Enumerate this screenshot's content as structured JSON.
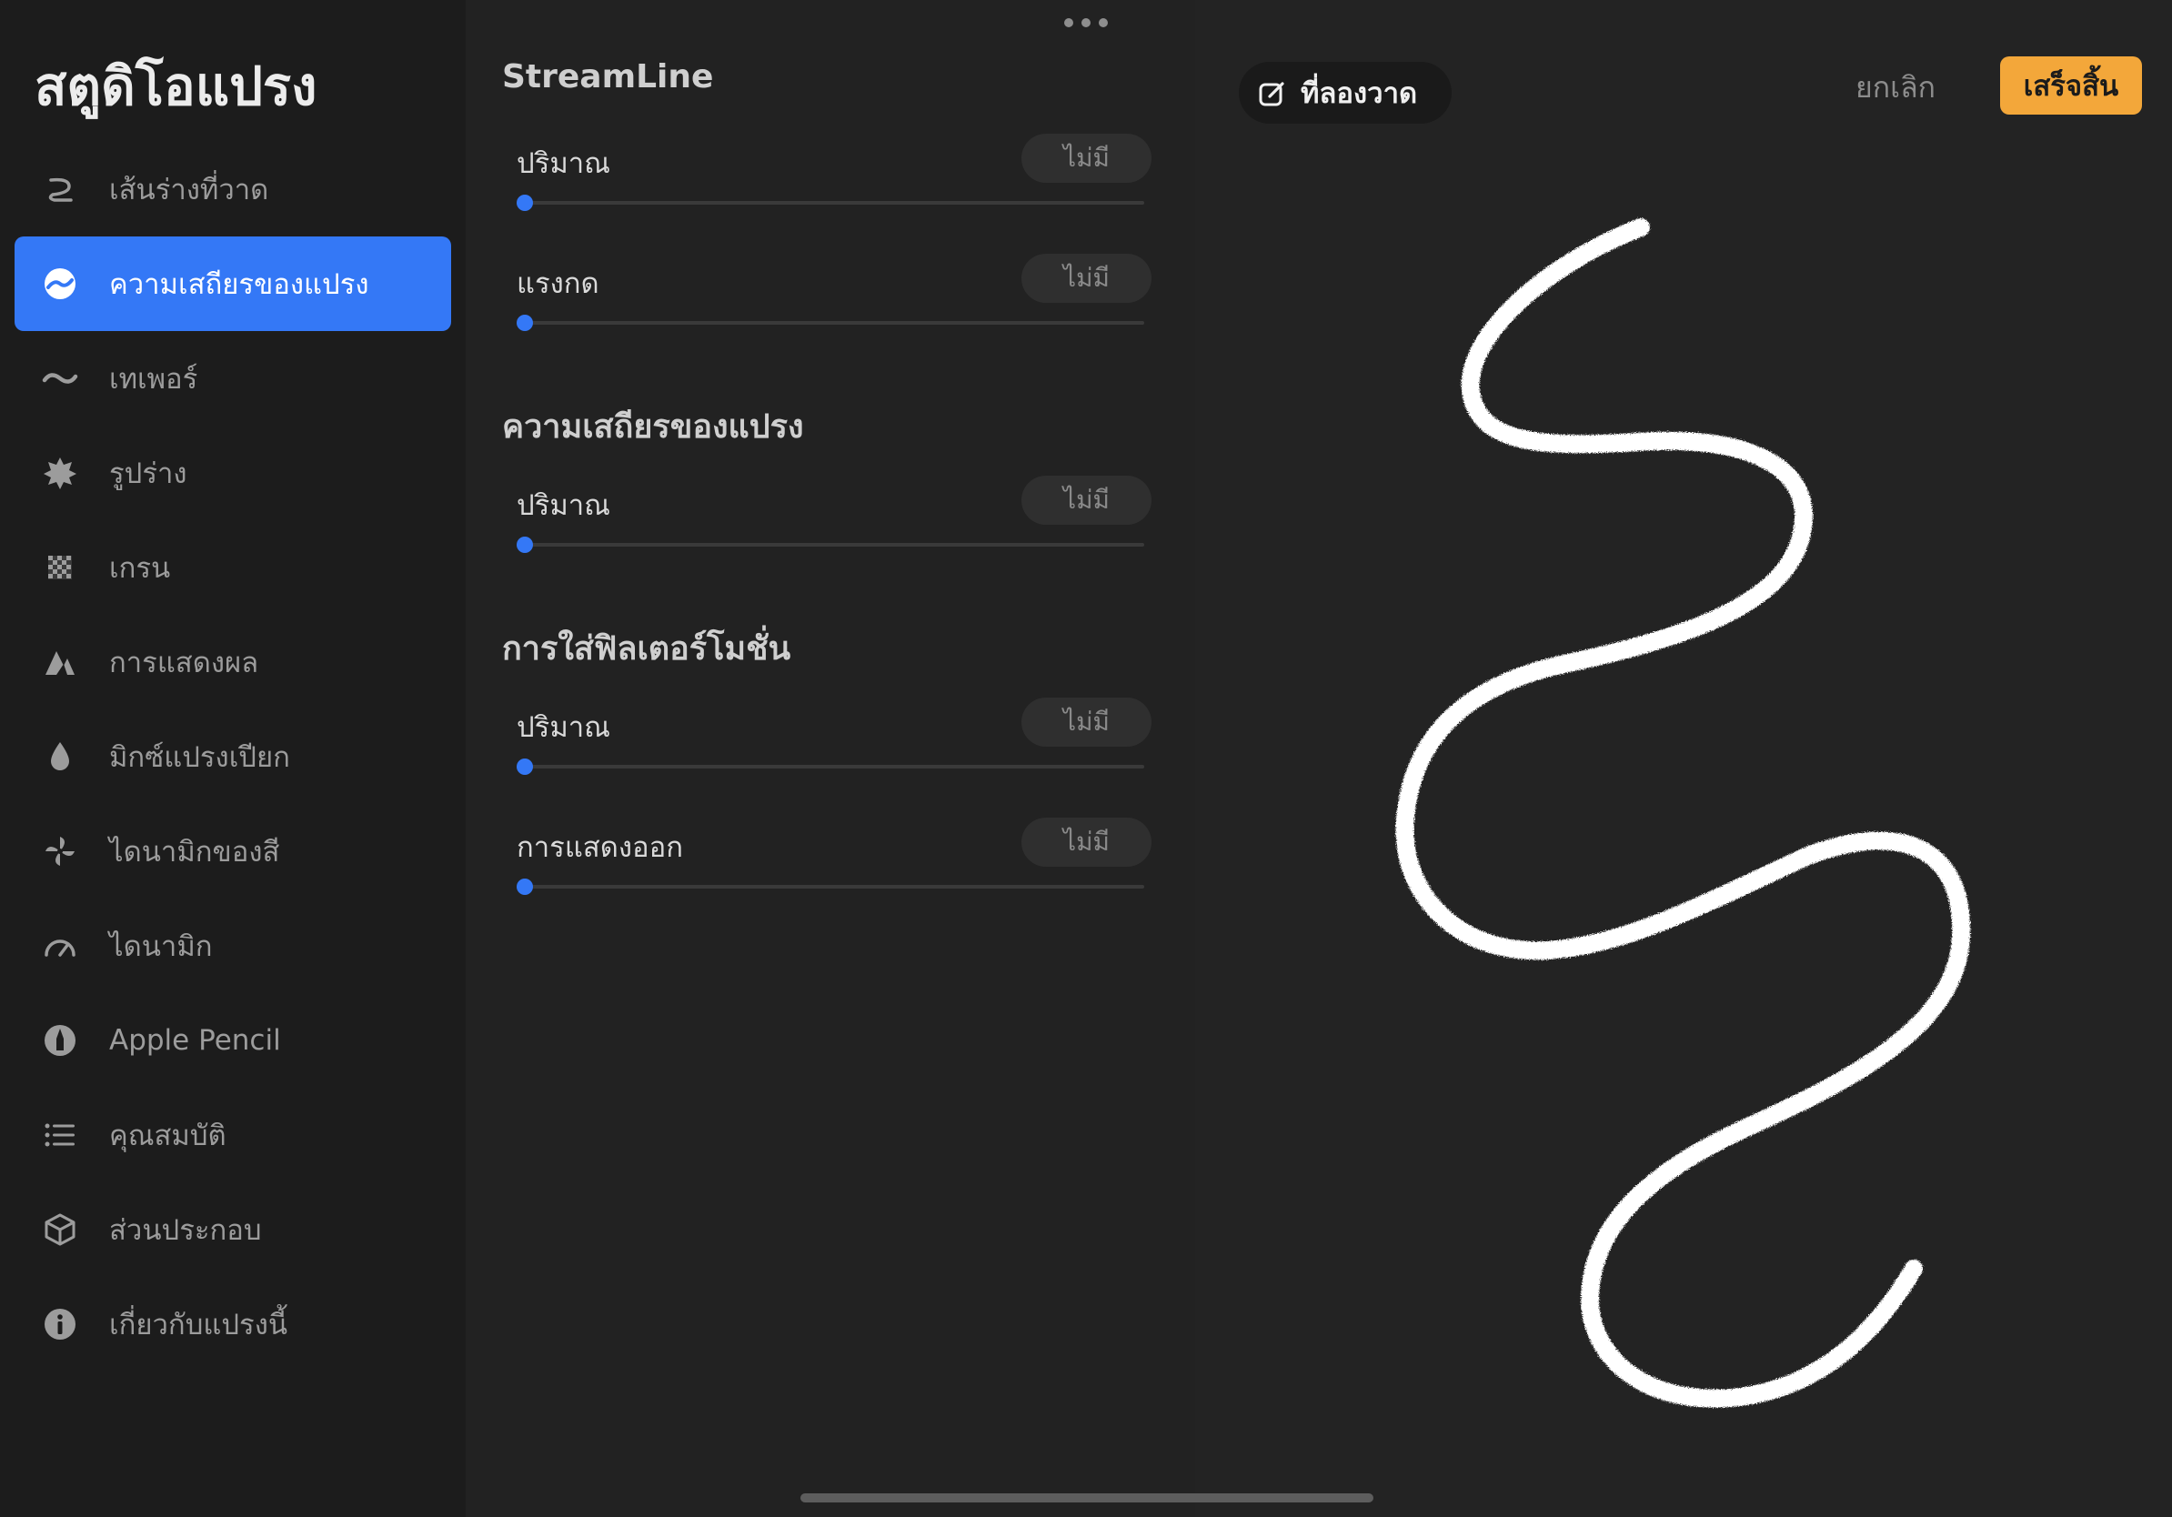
{
  "app": {
    "title": "สตูดิโอแปรง"
  },
  "sidebar": {
    "items": [
      {
        "label": "เส้นร่างที่วาด",
        "icon": "stroke-path-icon",
        "active": false
      },
      {
        "label": "ความเสถียรของแปรง",
        "icon": "stabilization-icon",
        "active": true
      },
      {
        "label": "เทเพอร์",
        "icon": "taper-icon",
        "active": false
      },
      {
        "label": "รูปร่าง",
        "icon": "shape-icon",
        "active": false
      },
      {
        "label": "เกรน",
        "icon": "grain-icon",
        "active": false
      },
      {
        "label": "การแสดงผล",
        "icon": "rendering-icon",
        "active": false
      },
      {
        "label": "มิกซ์แปรงเปียก",
        "icon": "wet-mix-icon",
        "active": false
      },
      {
        "label": "ไดนามิกของสี",
        "icon": "color-dynamics-icon",
        "active": false
      },
      {
        "label": "ไดนามิก",
        "icon": "dynamics-icon",
        "active": false
      },
      {
        "label": "Apple Pencil",
        "icon": "apple-pencil-icon",
        "active": false
      },
      {
        "label": "คุณสมบัติ",
        "icon": "properties-icon",
        "active": false
      },
      {
        "label": "ส่วนประกอบ",
        "icon": "materials-icon",
        "active": false
      },
      {
        "label": "เกี่ยวกับแปรงนี้",
        "icon": "info-icon",
        "active": false
      }
    ]
  },
  "settings": {
    "sections": [
      {
        "title": "StreamLine",
        "params": [
          {
            "label": "ปริมาณ",
            "value": "ไม่มี",
            "level": 0
          },
          {
            "label": "แรงกด",
            "value": "ไม่มี",
            "level": 0
          }
        ]
      },
      {
        "title": "ความเสถียรของแปรง",
        "params": [
          {
            "label": "ปริมาณ",
            "value": "ไม่มี",
            "level": 0
          }
        ]
      },
      {
        "title": "การใส่ฟิลเตอร์โมชั่น",
        "params": [
          {
            "label": "ปริมาณ",
            "value": "ไม่มี",
            "level": 0
          },
          {
            "label": "การแสดงออก",
            "value": "ไม่มี",
            "level": 0
          }
        ]
      }
    ]
  },
  "pad": {
    "chip_label": "ที่ลองวาด",
    "chip_icon": "edit-square-icon",
    "cancel_label": "ยกเลิก",
    "done_label": "เสร็จสิ้น"
  },
  "colors": {
    "accent": "#3478f6",
    "done": "#f3a73a",
    "stroke": "#ffffff"
  }
}
